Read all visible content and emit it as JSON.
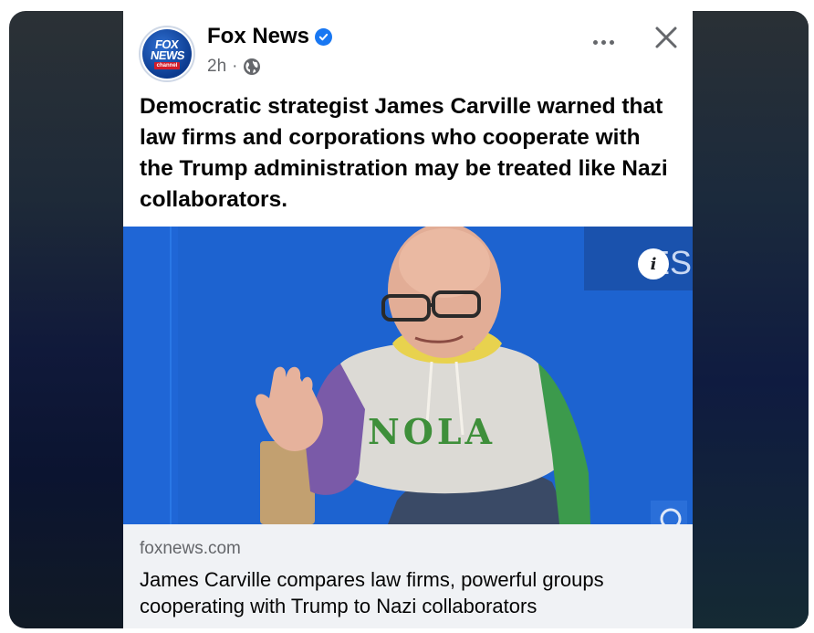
{
  "post": {
    "page_name": "Fox News",
    "logo": {
      "line1": "FOX",
      "line2": "NEWS",
      "line3": "channel"
    },
    "verified_icon": "verified-badge-icon",
    "time": "2h",
    "separator": "·",
    "audience_icon": "globe-icon",
    "more_icon": "more-options-icon",
    "close_icon": "close-icon",
    "text": "Democratic strategist James Carville warned that law firms and corporations who cooperate with the Trump administration may be treated like Nazi collaborators."
  },
  "media": {
    "shirt_text": "NOLA",
    "info_label": "i",
    "bg_sign_text": "ES"
  },
  "link": {
    "domain": "foxnews.com",
    "title": "James Carville compares law firms, powerful groups cooperating with Trump to Nazi collaborators"
  },
  "colors": {
    "brand_blue": "#1877f2",
    "text_primary": "#050505",
    "text_secondary": "#65676b",
    "link_bg": "#f0f2f5",
    "backdrop": "#10193a"
  }
}
